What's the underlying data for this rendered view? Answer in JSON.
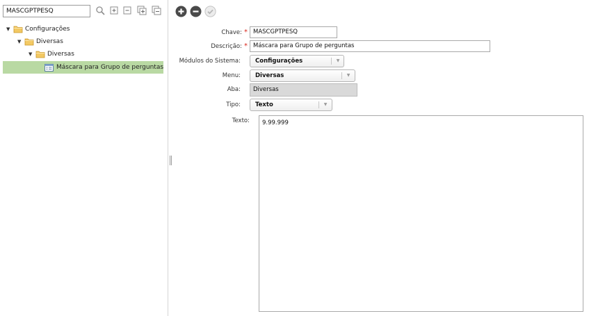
{
  "search": {
    "value": "MASCGPTPESQ"
  },
  "toolbar_icons": [
    "search-icon",
    "expand-node-icon",
    "collapse-node-icon",
    "expand-all-icon",
    "collapse-all-icon"
  ],
  "tree": {
    "root": {
      "label": "Configurações",
      "icon": "folder-icon"
    },
    "child": {
      "label": "Diversas",
      "icon": "folder-icon"
    },
    "grandchild": {
      "label": "Diversas",
      "icon": "folder-icon"
    },
    "leaf": {
      "label": "Máscara para Grupo de perguntas",
      "icon": "form-icon"
    }
  },
  "actions": {
    "add": {
      "icon": "plus-icon"
    },
    "remove": {
      "icon": "minus-icon"
    },
    "confirm": {
      "icon": "check-icon",
      "enabled": false
    }
  },
  "form": {
    "chave": {
      "label": "Chave:",
      "value": "MASCGPTPESQ",
      "required": true,
      "required_mark": "*"
    },
    "descricao": {
      "label": "Descrição:",
      "value": "Máscara para Grupo de perguntas",
      "required": true,
      "required_mark": "*"
    },
    "modulos": {
      "label": "Módulos do Sistema:",
      "value": "Configurações"
    },
    "menu": {
      "label": "Menu:",
      "value": "Diversas"
    },
    "aba": {
      "label": "Aba:",
      "value": "Diversas"
    },
    "tipo": {
      "label": "Tipo:",
      "value": "Texto"
    },
    "texto": {
      "label": "Texto:",
      "value": "9.99.999"
    }
  },
  "colors": {
    "selection": "#b9d9a3",
    "action_button": "#4a4a4a",
    "required": "#d9261c",
    "readonly_bg": "#d9d9d9"
  }
}
